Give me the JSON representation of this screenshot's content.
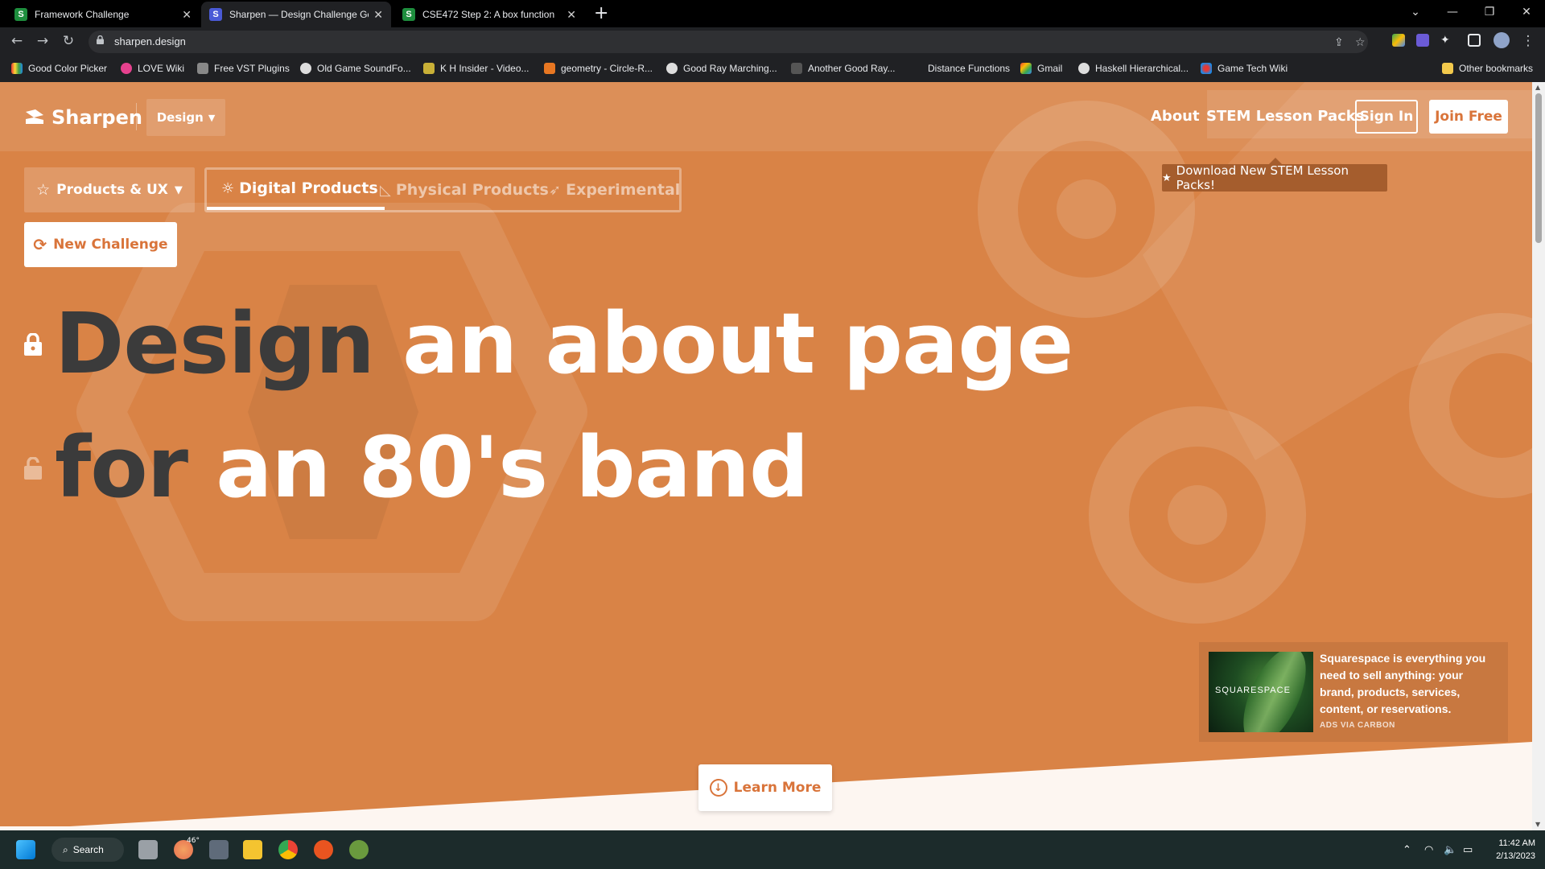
{
  "browser": {
    "tabs": [
      {
        "title": "Framework Challenge",
        "favicon": "S",
        "favicon_color": "#1e8e3e"
      },
      {
        "title": "Sharpen — Design Challenge Ge",
        "favicon": "S",
        "favicon_color": "#4a5ad6"
      },
      {
        "title": "CSE472 Step 2: A box function",
        "favicon": "S",
        "favicon_color": "#1e8e3e"
      }
    ],
    "new_tab_icon": "plus-icon",
    "url": "sharpen.design",
    "bookmarks": [
      "Good Color Picker",
      "LOVE Wiki",
      "Free VST Plugins",
      "Old Game SoundFo...",
      "K H Insider - Video...",
      "geometry - Circle-R...",
      "Good Ray Marching...",
      "Another Good Ray...",
      "Distance Functions",
      "Gmail",
      "Haskell Hierarchical...",
      "Game Tech Wiki"
    ],
    "other_bookmarks": "Other bookmarks"
  },
  "site": {
    "logo": "Sharpen",
    "design_dropdown": "Design",
    "nav": {
      "about": "About",
      "stem": "STEM Lesson Packs",
      "sign_in": "Sign In",
      "join": "Join Free"
    },
    "tooltip": "Download New STEM Lesson Packs!",
    "category": "Products & UX",
    "subtabs": [
      "Digital Products",
      "Physical Products",
      "Experimental"
    ],
    "new_challenge": "New Challenge",
    "headline": {
      "line1_dark": "Design",
      "line1_light": "an about page",
      "line2_dark": "for",
      "line2_light": "an 80's band"
    },
    "ad": {
      "brand": "SQUARESPACE",
      "text": "Squarespace is everything you need to sell anything: your brand, products, services, content, or reservations.",
      "via": "ADS VIA CARBON"
    },
    "learn_more": "Learn More",
    "colors": {
      "accent": "#d98346",
      "text_dark": "#3b3b3b"
    }
  },
  "taskbar": {
    "search": "Search",
    "weather": "46°",
    "time": "11:42 AM",
    "date": "2/13/2023"
  }
}
